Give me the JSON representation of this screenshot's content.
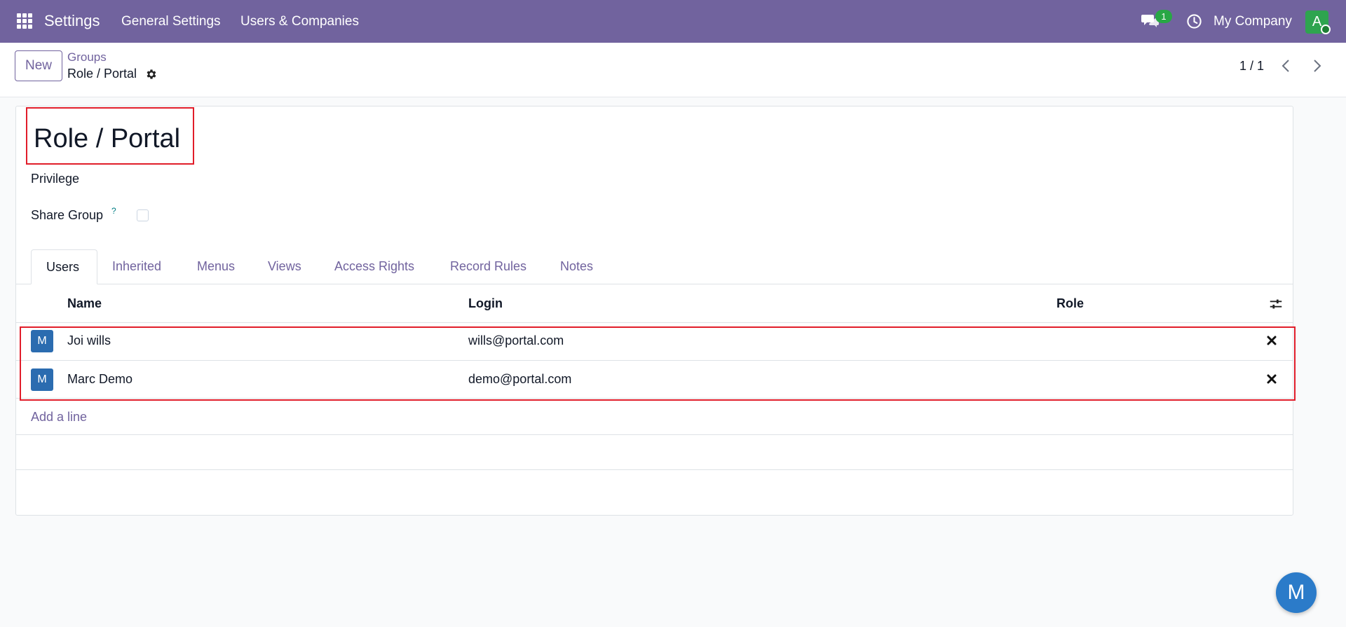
{
  "navbar": {
    "app_name": "Settings",
    "menu": [
      "General Settings",
      "Users & Companies"
    ],
    "chat_count": "1",
    "company": "My Company",
    "user_initial": "A"
  },
  "control_panel": {
    "new_label": "New",
    "breadcrumb_parent": "Groups",
    "breadcrumb_current": "Role / Portal",
    "pager": "1 / 1"
  },
  "form": {
    "title": "Role / Portal",
    "privilege_label": "Privilege",
    "share_group_label": "Share Group",
    "share_group_help": "?",
    "share_group_checked": false
  },
  "tabs": [
    {
      "label": "Users",
      "active": true
    },
    {
      "label": "Inherited",
      "active": false
    },
    {
      "label": "Menus",
      "active": false
    },
    {
      "label": "Views",
      "active": false
    },
    {
      "label": "Access Rights",
      "active": false
    },
    {
      "label": "Record Rules",
      "active": false
    },
    {
      "label": "Notes",
      "active": false
    }
  ],
  "users_table": {
    "columns": [
      "Name",
      "Login",
      "Role"
    ],
    "rows": [
      {
        "avatar": "M",
        "name": "Joi wills",
        "login": "wills@portal.com",
        "role": ""
      },
      {
        "avatar": "M",
        "name": "Marc Demo",
        "login": "demo@portal.com",
        "role": ""
      }
    ],
    "add_line_label": "Add a line"
  },
  "floating_avatar": "M",
  "colors": {
    "navbar": "#71639e",
    "accent": "#71639e",
    "highlight": "#e11d2a",
    "avatar_blue": "#2b6cb0"
  }
}
